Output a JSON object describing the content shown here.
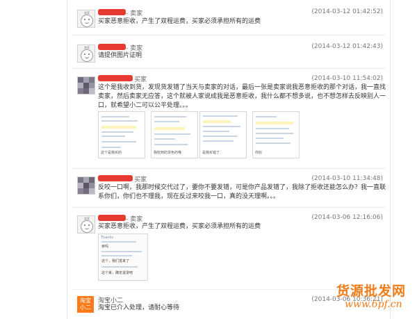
{
  "messages": [
    {
      "role": "卖家",
      "time": "(2014-03-12 01:42:52)",
      "avatar_text": "卖家",
      "text": "买家恶意拒收，产生了双程运费，买家必须承担所有的运费"
    },
    {
      "role": "卖家",
      "time": "(2014-03-12 01:42:43)",
      "avatar_text": "卖家",
      "text": "请提供图片证明"
    },
    {
      "role": "买家",
      "time": "(2014-03-10 11:54:02)",
      "text": "这个是我收到货，发现货发错了当天与卖家的对话，最后一张是卖家说我恶意拒收的那个对话，我一直找卖家，然后卖家无应答，这个就被人家说成我是恶意拒收，我什么都不想多说，也不想怎样去反映别人一口，就希望小二可以公平处理。。。",
      "thumb_captions": [
        "这个是我买的",
        "我收到的货色的哦",
        "是我买错了",
        "你好"
      ]
    },
    {
      "role": "买家",
      "time": "(2014-03-10 11:34:48)",
      "text": "反咬一口啊，我那时候交代过了，要你不要发错，可是你产品发错了，我除了拒收还能怎么办？我一直联系你们，你们也不理我，现在反过来咬我一口，真的没天理啊。。。"
    },
    {
      "role": "卖家",
      "time": "(2014-03-06 12:16:06)",
      "avatar_text": "卖家",
      "text": "买家恶意拒收，产生了双程运费，买家必须承担所有的运费",
      "thumb_captions": [
        "Thanks",
        "亲吗",
        "这个，我们发来了",
        "这个来，确定退货吧"
      ]
    },
    {
      "role": "淘宝小二",
      "time": "(2014-03-06 10:36:21)",
      "badge_lines": [
        "淘宝",
        "小二"
      ],
      "text": "淘宝已介入处理，请耐心等待"
    }
  ],
  "watermark": {
    "title": "货源批发网",
    "url": "www.6pf.cn"
  },
  "colors": {
    "redaction": "#e63a32",
    "official_badge": "#ff7a1a",
    "watermark": "#f07b19"
  }
}
